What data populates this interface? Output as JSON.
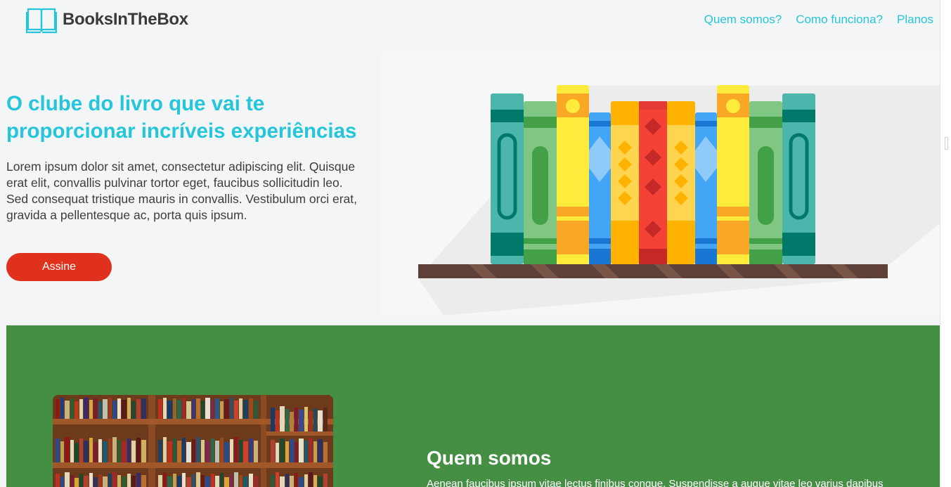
{
  "header": {
    "brand": "BooksInTheBox",
    "logo_icon": "open-book-icon",
    "nav": [
      "Quem somos?",
      "Como funciona?",
      "Planos"
    ]
  },
  "hero": {
    "title": "O clube do livro que vai te proporcionar incríveis experiências",
    "text": "Lorem ipsum dolor sit amet, consectetur adipiscing elit. Quisque erat elit, convallis pulvinar tortor eget, faucibus sollicitudin leo. Sed consequat tristique mauris in convallis. Vestibulum orci erat, gravida a pellentesque ac, porta quis ipsum.",
    "cta_label": "Assine",
    "illustration": "books-on-shelf-illustration"
  },
  "about": {
    "title": "Quem somos",
    "text": "Aenean faucibus ipsum vitae lectus finibus congue. Suspendisse a augue vitae leo varius dapibus",
    "image": "bookshelf-photo"
  },
  "colors": {
    "accent": "#26c6da",
    "cta": "#e0311c",
    "section_green": "#458f44",
    "text_dark": "#3d3d3d"
  }
}
